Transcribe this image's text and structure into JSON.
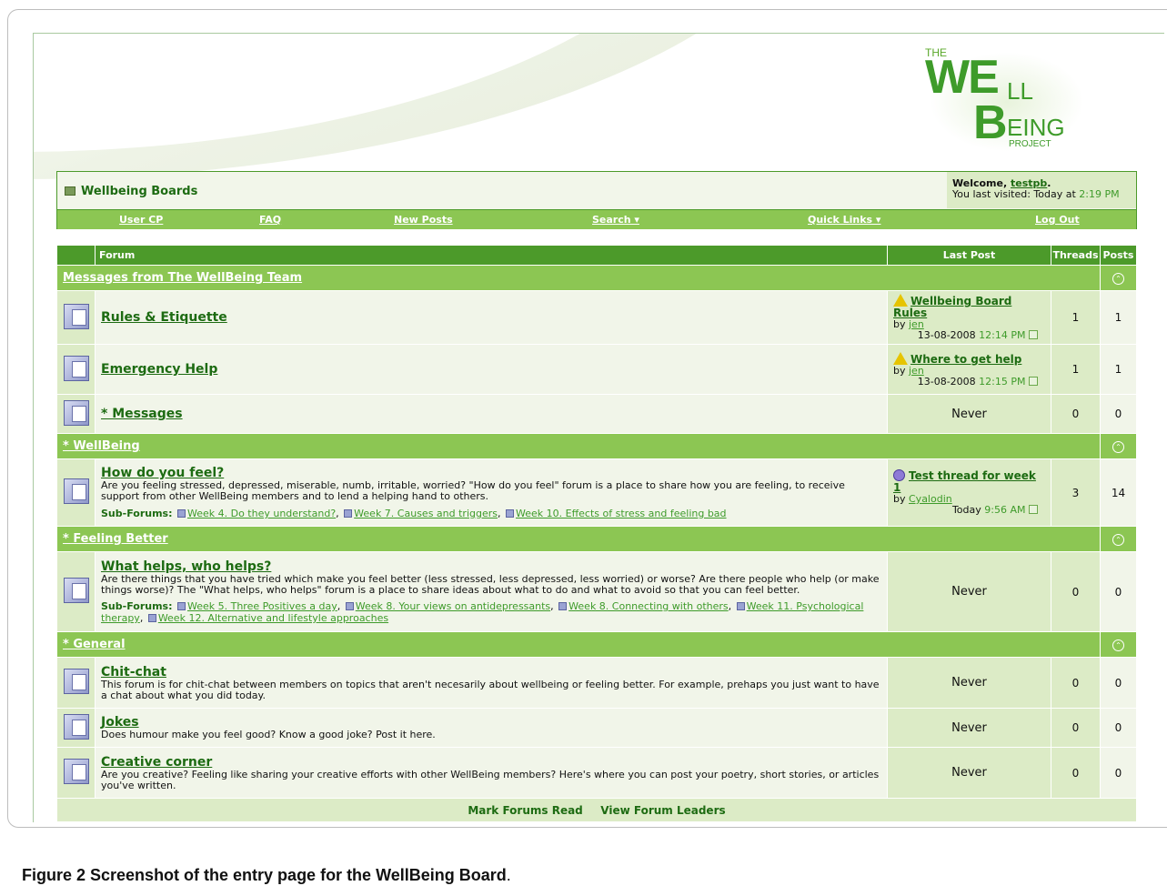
{
  "logo": {
    "the": "THE",
    "we": "WE",
    "ll": "LL",
    "b": "B",
    "eing": "EING",
    "project": "PROJECT"
  },
  "breadcrumb": "Wellbeing Boards",
  "welcome": {
    "prefix": "Welcome, ",
    "user": "testpb",
    "suffix": ".",
    "last_visit": "You last visited: Today at ",
    "time": "2:19 PM"
  },
  "navbar": [
    "User CP",
    "FAQ",
    "New Posts",
    "Search ▾",
    "Quick Links ▾",
    "Log Out"
  ],
  "table_header": {
    "forum": "Forum",
    "last_post": "Last Post",
    "threads": "Threads",
    "posts": "Posts"
  },
  "categories": [
    {
      "title": "Messages from The WellBeing Team",
      "forums": [
        {
          "title": "Rules & Etiquette",
          "last_post": {
            "title": "Wellbeing Board Rules",
            "by": "jen",
            "date": "13-08-2008",
            "time": "12:14 PM",
            "icon": "warning-icon"
          },
          "threads": "1",
          "posts": "1"
        },
        {
          "title": "Emergency Help",
          "last_post": {
            "title": "Where to get help",
            "by": "jen",
            "date": "13-08-2008",
            "time": "12:15 PM",
            "icon": "warning-icon"
          },
          "threads": "1",
          "posts": "1"
        },
        {
          "title": "* Messages",
          "last_post_never": "Never",
          "threads": "0",
          "posts": "0"
        }
      ]
    },
    {
      "title": "* WellBeing",
      "forums": [
        {
          "title": "How do you feel?",
          "description": "Are you feeling stressed, depressed, miserable, numb, irritable, worried? \"How do you feel\" forum is a place to share how you are feeling, to receive support from other WellBeing members and to lend a helping hand to others.",
          "subforums_label": "Sub-Forums:",
          "subforums": [
            "Week 4. Do they understand?",
            "Week 7. Causes and triggers",
            "Week 10. Effects of stress and feeling bad"
          ],
          "last_post": {
            "title": "Test thread for week 1",
            "by": "Cyalodin",
            "date": "Today",
            "time": "9:56 AM",
            "icon": "sad-face-icon"
          },
          "threads": "3",
          "posts": "14"
        }
      ]
    },
    {
      "title": "* Feeling Better",
      "forums": [
        {
          "title": "What helps, who helps?",
          "description": "Are there things that you have tried which make you feel better (less stressed, less depressed, less worried) or worse? Are there people who help (or make things worse)? The \"What helps, who helps\" forum is a place to share ideas about what to do and what to avoid so that you can feel better.",
          "subforums_label": "Sub-Forums:",
          "subforums": [
            "Week 5. Three Positives a day",
            "Week 8. Your views on antidepressants",
            "Week 8. Connecting with others",
            "Week 11. Psychological therapy",
            "Week 12. Alternative and lifestyle approaches"
          ],
          "last_post_never": "Never",
          "threads": "0",
          "posts": "0"
        }
      ]
    },
    {
      "title": "* General",
      "forums": [
        {
          "title": "Chit-chat",
          "description": "This forum is for chit-chat between members on topics that aren't necesarily about wellbeing or feeling better. For example, prehaps you just want to have a chat about what you did today.",
          "last_post_never": "Never",
          "threads": "0",
          "posts": "0"
        },
        {
          "title": "Jokes",
          "description": "Does humour make you feel good? Know a good joke? Post it here.",
          "last_post_never": "Never",
          "threads": "0",
          "posts": "0"
        },
        {
          "title": "Creative corner",
          "description": "Are you creative? Feeling like sharing your creative efforts with other WellBeing members? Here's where you can post your poetry, short stories, or articles you've written.",
          "last_post_never": "Never",
          "threads": "0",
          "posts": "0"
        }
      ]
    }
  ],
  "footer_links": [
    "Mark Forums Read",
    "View Forum Leaders"
  ],
  "caption": {
    "label": "Figure 2",
    "text": " Screenshot of the entry page for the WellBeing Board",
    "end": "."
  }
}
